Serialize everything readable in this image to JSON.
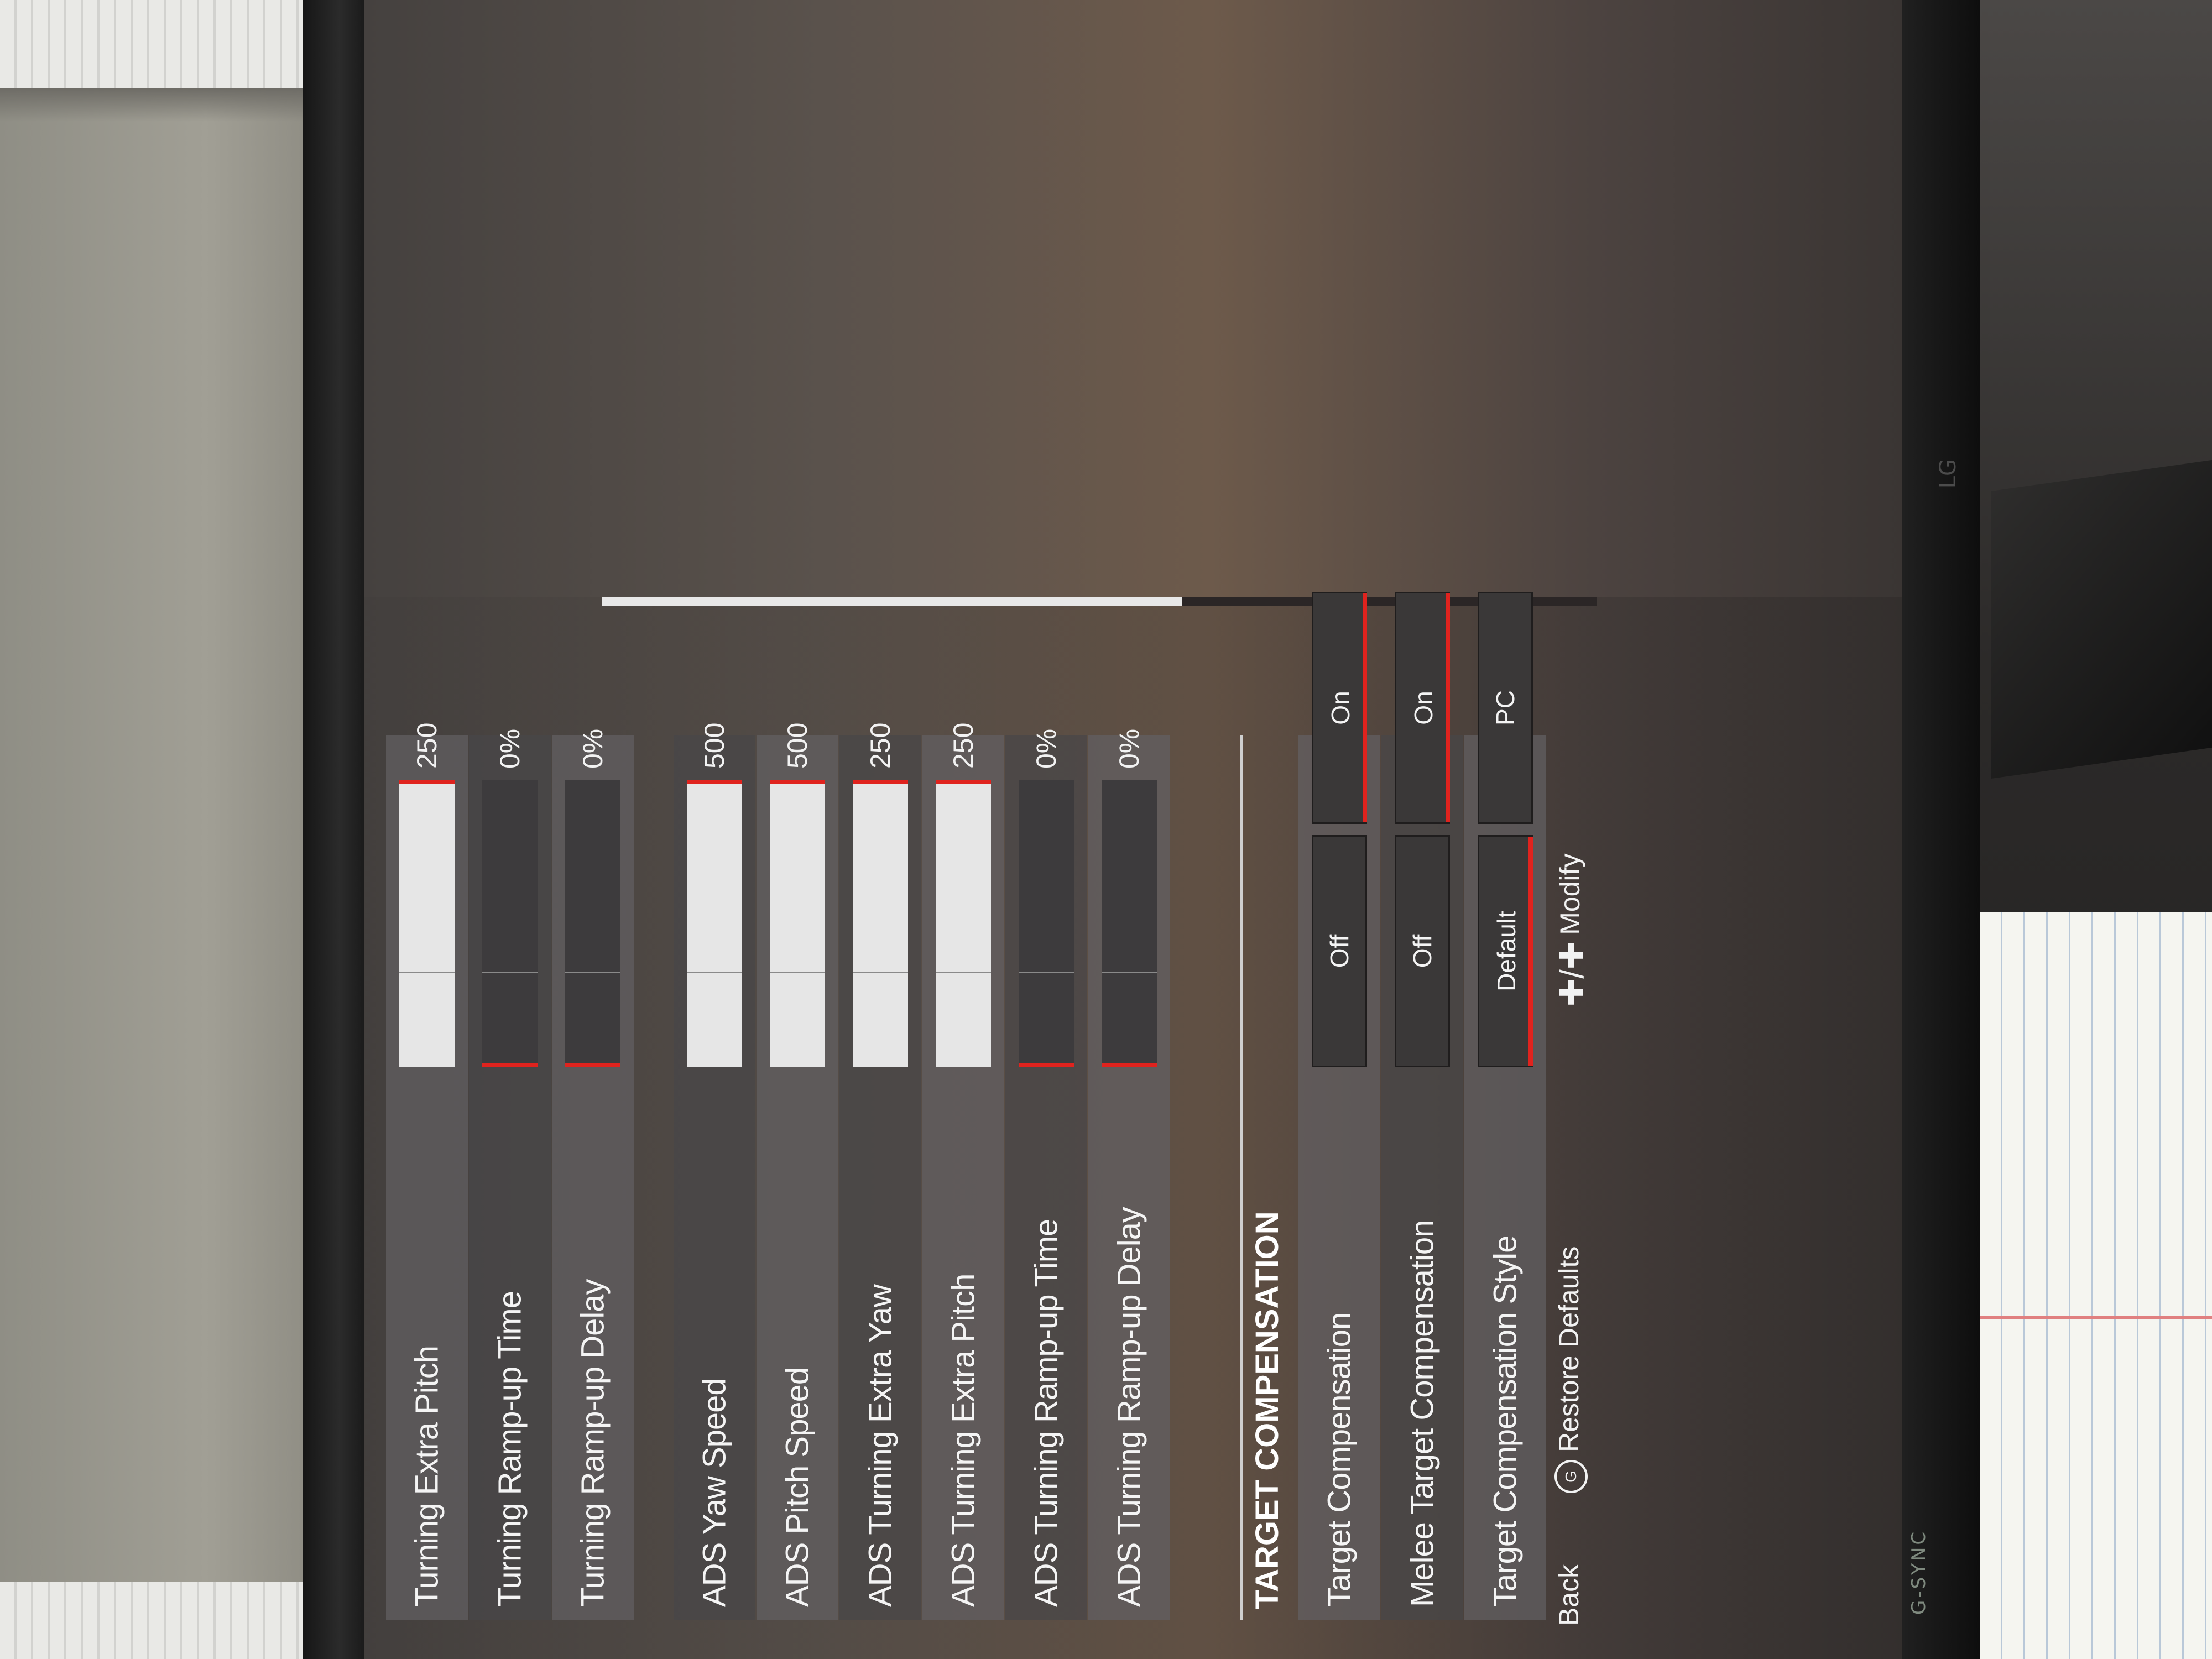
{
  "settings": {
    "rows": [
      {
        "label": "Turning Extra Pitch",
        "value": "250",
        "fill": 1.0
      },
      {
        "label": "Turning Ramp-up Time",
        "value": "0%",
        "fill": 0.0
      },
      {
        "label": "Turning Ramp-up Delay",
        "value": "0%",
        "fill": 0.0
      },
      {
        "label": "ADS Yaw Speed",
        "value": "500",
        "fill": 1.0
      },
      {
        "label": "ADS Pitch Speed",
        "value": "500",
        "fill": 1.0
      },
      {
        "label": "ADS Turning Extra Yaw",
        "value": "250",
        "fill": 1.0
      },
      {
        "label": "ADS Turning Extra Pitch",
        "value": "250",
        "fill": 1.0
      },
      {
        "label": "ADS Turning Ramp-up Time",
        "value": "0%",
        "fill": 0.0
      },
      {
        "label": "ADS Turning Ramp-up Delay",
        "value": "0%",
        "fill": 0.0
      }
    ]
  },
  "target_compensation": {
    "title": "TARGET COMPENSATION",
    "rows": [
      {
        "label": "Target Compensation",
        "options": [
          "Off",
          "On"
        ],
        "selected": "On"
      },
      {
        "label": "Melee Target Compensation",
        "options": [
          "Off",
          "On"
        ],
        "selected": "On"
      },
      {
        "label": "Target Compensation Style",
        "options": [
          "Default",
          "PC"
        ],
        "selected": "Default"
      }
    ]
  },
  "footer": {
    "back": "Back",
    "restore": "Restore Defaults",
    "modify": "Modify",
    "restore_icon": "button-icon",
    "modify_icon": "dpad-left-right-icon"
  },
  "bezel": {
    "gsync": "G-SYNC",
    "logo": "LG"
  },
  "colors": {
    "accent": "#e0231e",
    "fill": "#e6e6e6"
  }
}
